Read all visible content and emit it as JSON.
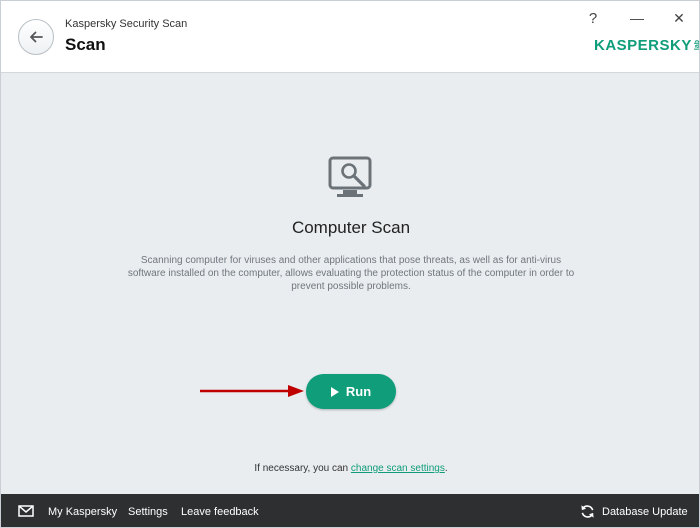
{
  "header": {
    "app_title": "Kaspersky Security Scan",
    "page_title": "Scan",
    "help_label": "?",
    "minimize_label": "—",
    "close_label": "✕",
    "logo_text": "KASPERSKY",
    "logo_lab": "lab"
  },
  "main": {
    "title": "Computer Scan",
    "description": "Scanning computer for viruses and other applications that pose threats, as well as for anti-virus software installed on the computer, allows evaluating the protection status of the computer in order to prevent possible problems.",
    "run_label": "Run",
    "settings_prefix": "If necessary, you can ",
    "settings_link": "change scan settings",
    "settings_suffix": "."
  },
  "footer": {
    "my_kaspersky": "My Kaspersky",
    "settings": "Settings",
    "leave_feedback": "Leave feedback",
    "database_update": "Database Update"
  },
  "colors": {
    "accent": "#0f9d7a",
    "footer_bg": "#2d2f31",
    "content_bg": "#e9edf0",
    "arrow": "#c00000"
  }
}
